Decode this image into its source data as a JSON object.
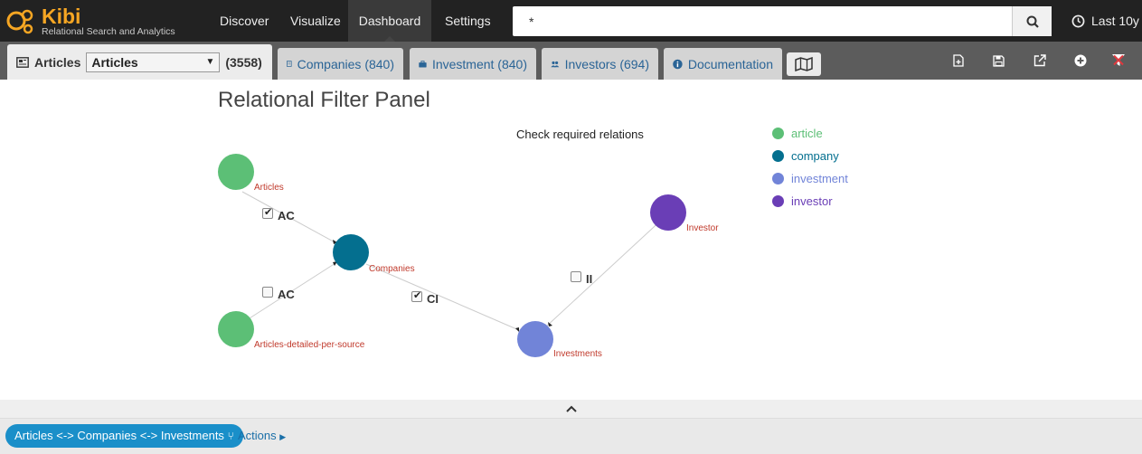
{
  "app": {
    "logo_text": "Kibi",
    "logo_tagline": "Relational Search and Analytics"
  },
  "nav": {
    "items": [
      {
        "label": "Discover"
      },
      {
        "label": "Visualize"
      },
      {
        "label": "Dashboard",
        "active": true
      },
      {
        "label": "Settings"
      }
    ]
  },
  "search": {
    "value": "*",
    "button_icon": "search-icon"
  },
  "timepicker": {
    "label": "Last 10y",
    "icon": "clock-icon"
  },
  "tabs": {
    "active": {
      "label": "Articles",
      "select_value": "Articles",
      "count": "(3558)",
      "icon": "newspaper-icon"
    },
    "items": [
      {
        "label": "Companies (840)",
        "icon": "building-icon"
      },
      {
        "label": "Investment (840)",
        "icon": "briefcase-icon"
      },
      {
        "label": "Investors (694)",
        "icon": "users-icon"
      },
      {
        "label": "Documentation",
        "icon": "info-icon"
      }
    ],
    "map_icon": "map-icon"
  },
  "toolbar": {
    "icons": [
      "new-dashboard-icon",
      "save-icon",
      "share-icon",
      "add-icon",
      "kibi-filter-icon"
    ]
  },
  "panel": {
    "title": "Relational Filter Panel",
    "check_title": "Check required relations"
  },
  "colors": {
    "article": "#5cbf76",
    "company": "#046f8f",
    "investment": "#7184d8",
    "investor": "#6a3eb6",
    "node_label": "#c0392b"
  },
  "graph": {
    "nodes": [
      {
        "id": "articles",
        "label": "Articles",
        "type": "article"
      },
      {
        "id": "companies",
        "label": "Companies",
        "type": "company"
      },
      {
        "id": "articles_detailed",
        "label": "Articles-detailed-per-source",
        "type": "article"
      },
      {
        "id": "investments",
        "label": "Investments",
        "type": "investment"
      },
      {
        "id": "investor",
        "label": "Investor",
        "type": "investor"
      }
    ],
    "relations": [
      {
        "label": "AC",
        "checked": true
      },
      {
        "label": "AC",
        "checked": false
      },
      {
        "label": "CI",
        "checked": true
      },
      {
        "label": "II",
        "checked": false
      }
    ]
  },
  "legend": [
    {
      "label": "article",
      "color": "#5cbf76"
    },
    {
      "label": "company",
      "color": "#046f8f"
    },
    {
      "label": "investment",
      "color": "#7184d8"
    },
    {
      "label": "investor",
      "color": "#6a3eb6"
    }
  ],
  "bottom": {
    "relation_pill": "Articles <-> Companies <-> Investments",
    "actions_label": "Actions"
  }
}
